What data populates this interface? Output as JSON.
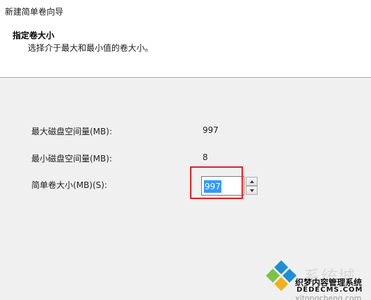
{
  "window": {
    "title": "新建简单卷向导"
  },
  "page": {
    "heading": "指定卷大小",
    "description": "选择介于最大和最小值的卷大小。"
  },
  "fields": {
    "max_label": "最大磁盘空间量(MB):",
    "max_value": "997",
    "min_label": "最小磁盘空间量(MB):",
    "min_value": "8",
    "size_label": "简单卷大小(MB)(S):",
    "size_value": "997"
  },
  "icons": {
    "spin_up": "arrow-up-icon",
    "spin_down": "arrow-down-icon",
    "watermark_logo": "windows-logo-icon"
  },
  "watermark": {
    "brand": "系统城",
    "site_cn": "织梦内容管理系统",
    "site_en": "DEDECMS.COM",
    "url": "xitongcheng.com"
  },
  "colors": {
    "header_bg": "#ffffff",
    "body_bg": "#f0f0f0",
    "selection": "#3399ff",
    "highlight_border": "#e02020",
    "logo_blue": "#1e8fd6",
    "logo_green": "#7cc243"
  }
}
